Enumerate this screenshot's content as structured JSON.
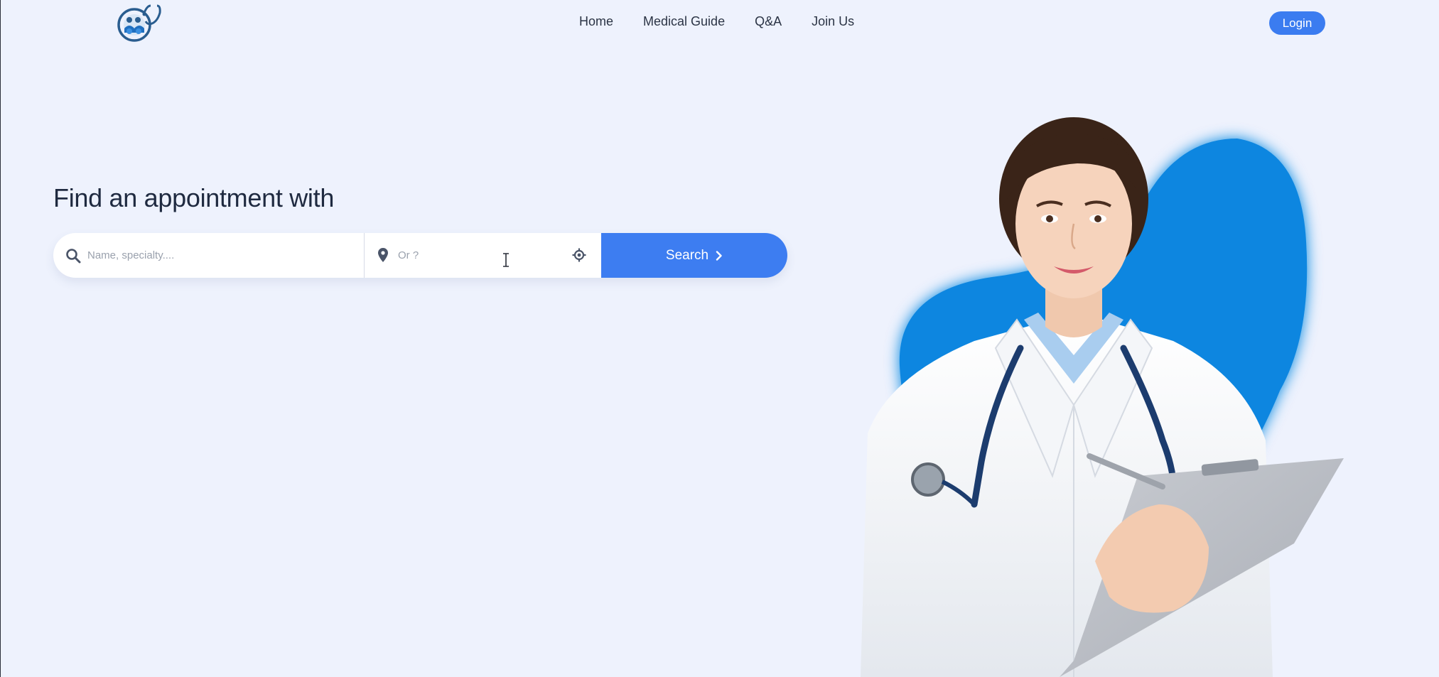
{
  "header": {
    "nav": [
      "Home",
      "Medical Guide",
      "Q&A",
      "Join Us"
    ],
    "login_label": "Login"
  },
  "hero": {
    "title": "Find an appointment with",
    "search": {
      "name_placeholder": "Name, specialty....",
      "location_placeholder": "Or ?",
      "button_label": "Search"
    }
  },
  "colors": {
    "background": "#eef2fd",
    "accent": "#3d7df1",
    "blob": "#0b86e0"
  },
  "icons": [
    "logo-icon",
    "search-icon",
    "location-pin-icon",
    "locate-target-icon",
    "chevron-right-icon",
    "text-cursor-icon"
  ]
}
